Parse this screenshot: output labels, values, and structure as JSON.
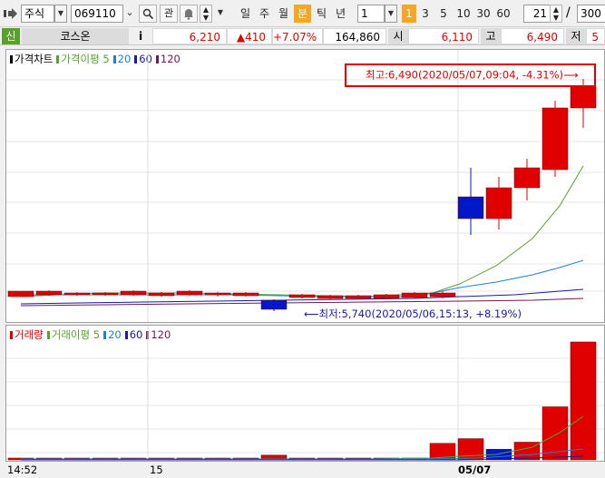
{
  "toolbar": {
    "market_type": "주식",
    "stock_code": "069110",
    "btn_watch": "관",
    "period_tabs": [
      "일",
      "주",
      "월",
      "분",
      "틱",
      "년"
    ],
    "active_period": "분",
    "interval_value": "1",
    "interval_buttons": [
      "1",
      "3",
      "5",
      "10",
      "30",
      "60"
    ],
    "active_interval": "1",
    "display_count": "21",
    "slash": "/",
    "total_count": "300"
  },
  "info_bar": {
    "credit_badge": "신",
    "stock_name": "코스온",
    "info_icon": "i",
    "current_price": "6,210",
    "change": "▲410",
    "change_rate": "+7.07%",
    "volume": "164,860",
    "open_label": "시",
    "open_price": "6,110",
    "high_label": "고",
    "high_price": "6,490",
    "low_label": "저",
    "low_price": "5"
  },
  "price_pane": {
    "legend": {
      "title": "가격차트",
      "ma_label": "가격이평",
      "ma_periods": [
        "5",
        "20",
        "60",
        "120"
      ]
    },
    "high_annotation": "최고:6,490(2020/05/07,09:04, -4.31%)⟶",
    "low_annotation": "⟵최저:5,740(2020/05/06,15:13, +8.19%)"
  },
  "volume_pane": {
    "legend": {
      "title": "거래량",
      "ma_label": "거래이평",
      "ma_periods": [
        "5",
        "20",
        "60",
        "120"
      ]
    }
  },
  "x_axis": {
    "labels": [
      "14:52",
      "15",
      "05/07"
    ]
  },
  "colors": {
    "up": "#e00000",
    "down": "#0018c8",
    "ma5": "#5aa02c",
    "ma20": "#1f7fd6",
    "ma60": "#1a1aa0",
    "ma120": "#6b1a5a",
    "accent": "#f5a623",
    "annotation_box": "#e00000"
  },
  "chart_data": {
    "type": "candlestick",
    "price_pane": {
      "high": 6490,
      "low": 5740,
      "candles": [
        {
          "t": "14:52",
          "direction": "up"
        },
        {
          "t": "",
          "direction": "up"
        },
        {
          "t": "",
          "direction": "up"
        },
        {
          "t": "",
          "direction": "up"
        },
        {
          "t": "",
          "direction": "up"
        },
        {
          "t": "",
          "direction": "up"
        },
        {
          "t": "",
          "direction": "up"
        },
        {
          "t": "",
          "direction": "up"
        },
        {
          "t": "",
          "direction": "up"
        },
        {
          "t": "",
          "direction": "down"
        },
        {
          "t": "",
          "direction": "up"
        },
        {
          "t": "",
          "direction": "up"
        },
        {
          "t": "",
          "direction": "up"
        },
        {
          "t": "",
          "direction": "up"
        },
        {
          "t": "",
          "direction": "up"
        },
        {
          "t": "",
          "direction": "up"
        },
        {
          "t": "05/07",
          "direction": "down"
        },
        {
          "t": "",
          "direction": "up"
        },
        {
          "t": "",
          "direction": "up"
        },
        {
          "t": "",
          "direction": "up"
        },
        {
          "t": "",
          "direction": "up"
        }
      ]
    },
    "volume_pane": {
      "bars": [
        {
          "direction": "up",
          "level": 0.01
        },
        {
          "direction": "up",
          "level": 0.01
        },
        {
          "direction": "up",
          "level": 0.01
        },
        {
          "direction": "up",
          "level": 0.01
        },
        {
          "direction": "up",
          "level": 0.01
        },
        {
          "direction": "up",
          "level": 0.01
        },
        {
          "direction": "up",
          "level": 0.01
        },
        {
          "direction": "up",
          "level": 0.01
        },
        {
          "direction": "up",
          "level": 0.01
        },
        {
          "direction": "up",
          "level": 0.04
        },
        {
          "direction": "up",
          "level": 0.01
        },
        {
          "direction": "up",
          "level": 0.01
        },
        {
          "direction": "up",
          "level": 0.01
        },
        {
          "direction": "up",
          "level": 0.01
        },
        {
          "direction": "up",
          "level": 0.01
        },
        {
          "direction": "up",
          "level": 0.14
        },
        {
          "direction": "up",
          "level": 0.18
        },
        {
          "direction": "down",
          "level": 0.09
        },
        {
          "direction": "up",
          "level": 0.15
        },
        {
          "direction": "up",
          "level": 0.45
        },
        {
          "direction": "up",
          "level": 1.0
        }
      ]
    }
  }
}
